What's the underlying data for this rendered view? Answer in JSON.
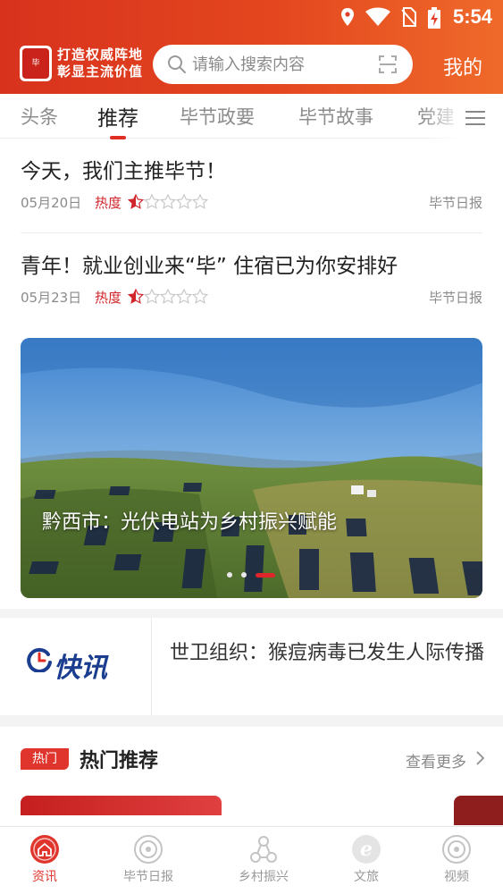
{
  "status_bar": {
    "time": "5:54"
  },
  "header": {
    "slogan_line1": "打造权威阵地",
    "slogan_line2": "彰显主流价值",
    "search_placeholder": "请输入搜索内容",
    "mine_label": "我的"
  },
  "tabs": [
    {
      "label": "头条",
      "active": false
    },
    {
      "label": "推荐",
      "active": true
    },
    {
      "label": "毕节政要",
      "active": false
    },
    {
      "label": "毕节故事",
      "active": false
    },
    {
      "label": "党建",
      "active": false
    }
  ],
  "news": [
    {
      "title": "今天，我们主推毕节！",
      "date": "05月20日",
      "heat_label": "热度",
      "heat_rating": 1,
      "source": "毕节日报"
    },
    {
      "title": "青年！就业创业来“毕” 住宿已为你安排好",
      "date": "05月23日",
      "heat_label": "热度",
      "heat_rating": 1,
      "source": "毕节日报"
    }
  ],
  "banner": {
    "caption": "黔西市：光伏电站为乡村振兴赋能",
    "slide_count": 3,
    "active_slide": 3
  },
  "flash": {
    "logo_text": "快讯",
    "text": "世卫组织：猴痘病毒已发生人际传播"
  },
  "hot": {
    "badge": "热门",
    "title": "热门推荐",
    "more": "查看更多"
  },
  "bottom_nav": [
    {
      "label": "资讯",
      "icon": "news-icon",
      "active": true
    },
    {
      "label": "毕节日报",
      "icon": "daily-icon",
      "active": false
    },
    {
      "label": "乡村振兴",
      "icon": "rural-icon",
      "active": false
    },
    {
      "label": "文旅",
      "icon": "tourism-icon",
      "active": false
    },
    {
      "label": "视频",
      "icon": "video-icon",
      "active": false
    }
  ],
  "colors": {
    "brand_red": "#e0352c",
    "header_start": "#d8321d",
    "header_end": "#ef6a2a",
    "heat_red": "#d0252a"
  }
}
